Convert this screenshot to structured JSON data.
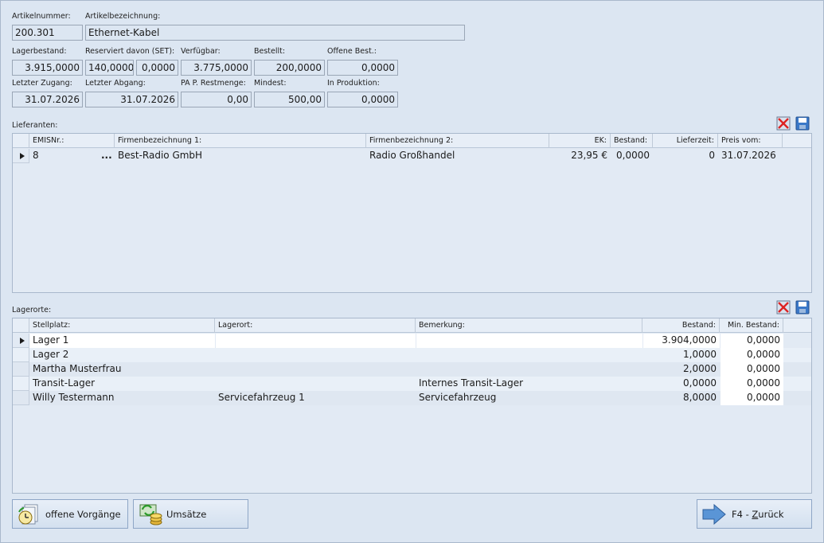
{
  "article": {
    "nr_label": "Artikelnummer:",
    "nr_value": "200.301",
    "name_label": "Artikelbezeichnung:",
    "name_value": "Ethernet-Kabel"
  },
  "stock": {
    "lagerbestand_label": "Lagerbestand:",
    "lagerbestand_value": "3.915,0000",
    "reserviert_label": "Reserviert davon (SET):",
    "reserviert_value": "140,0000",
    "reserviert_set_value": "0,0000",
    "verfuegbar_label": "Verfügbar:",
    "verfuegbar_value": "3.775,0000",
    "bestellt_label": "Bestellt:",
    "bestellt_value": "200,0000",
    "offene_label": "Offene Best.:",
    "offene_value": "0,0000",
    "zugang_label": "Letzter Zugang:",
    "zugang_value": "31.07.2026",
    "abgang_label": "Letzter Abgang:",
    "abgang_value": "31.07.2026",
    "pap_label": "PA P. Restmenge:",
    "pap_value": "0,00",
    "mindest_label": "Mindest:",
    "mindest_value": "500,00",
    "produktion_label": "In Produktion:",
    "produktion_value": "0,0000"
  },
  "suppliers": {
    "title": "Lieferanten:",
    "headers": {
      "emis": "EMISNr.:",
      "firma1": "Firmenbezeichnung 1:",
      "firma2": "Firmenbezeichnung 2:",
      "ek": "EK:",
      "bestand": "Bestand:",
      "lieferzeit": "Lieferzeit:",
      "preis": "Preis vom:"
    },
    "rows": [
      {
        "emis": "8",
        "dots": "...",
        "firma1": "Best-Radio GmbH",
        "firma2": "Radio Großhandel",
        "ek": "23,95 €",
        "bestand": "0,0000",
        "lieferzeit": "0",
        "preis": "31.07.2026"
      }
    ]
  },
  "locations": {
    "title": "Lagerorte:",
    "headers": {
      "stellplatz": "Stellplatz:",
      "lagerort": "Lagerort:",
      "bemerkung": "Bemerkung:",
      "bestand": "Bestand:",
      "min": "Min. Bestand:"
    },
    "rows": [
      {
        "stellplatz": "Lager 1",
        "lagerort": "",
        "bemerkung": "",
        "bestand": "3.904,0000",
        "min": "0,0000"
      },
      {
        "stellplatz": "Lager 2",
        "lagerort": "",
        "bemerkung": "",
        "bestand": "1,0000",
        "min": "0,0000"
      },
      {
        "stellplatz": "Martha Musterfrau",
        "lagerort": "",
        "bemerkung": "",
        "bestand": "2,0000",
        "min": "0,0000"
      },
      {
        "stellplatz": "Transit-Lager",
        "lagerort": "",
        "bemerkung": "Internes Transit-Lager",
        "bestand": "0,0000",
        "min": "0,0000"
      },
      {
        "stellplatz": "Willy Testermann",
        "lagerort": "Servicefahrzeug 1",
        "bemerkung": "Servicefahrzeug",
        "bestand": "8,0000",
        "min": "0,0000"
      }
    ]
  },
  "buttons": {
    "offene": "offene Vorgänge",
    "umsaetze": "Umsätze",
    "zurueck_prefix": "F4 - ",
    "zurueck_underlined": "Z",
    "zurueck_suffix": "urück"
  },
  "colors": {
    "background": "#dce6f2",
    "border": "#a9b8cc",
    "accent": "#3a78c8"
  }
}
